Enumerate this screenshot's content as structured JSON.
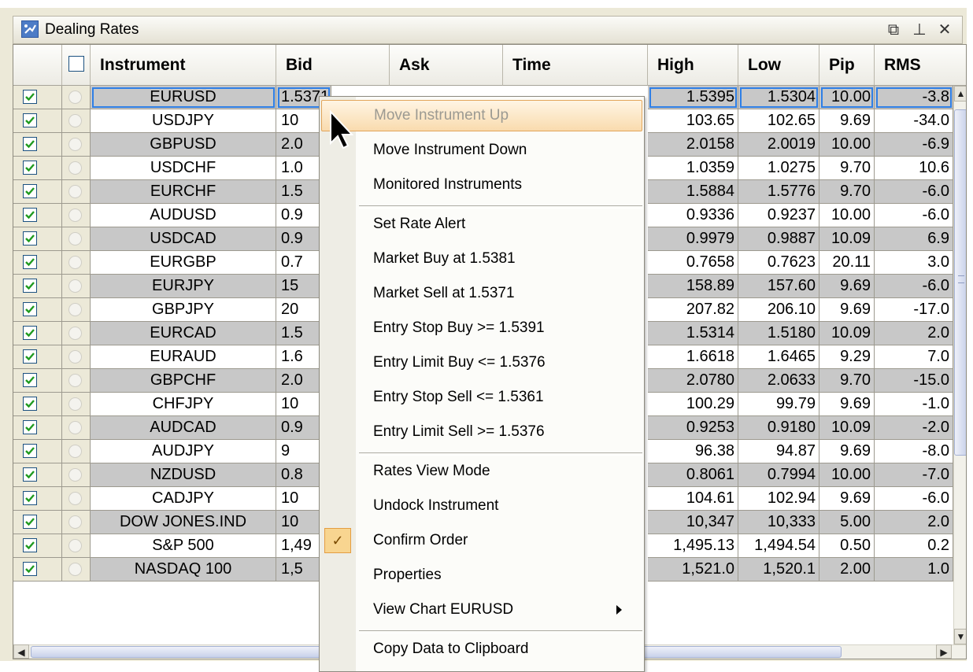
{
  "window": {
    "title": "Dealing Rates"
  },
  "columns": [
    "Instrument",
    "Bid",
    "Ask",
    "Time",
    "High",
    "Low",
    "Pip",
    "RMS"
  ],
  "rows": [
    {
      "instrument": "EURUSD",
      "bid": "1.5371",
      "high": "1.5395",
      "low": "1.5304",
      "pip": "10.00",
      "rvs": "-3.8"
    },
    {
      "instrument": "USDJPY",
      "bid": "10",
      "high": "103.65",
      "low": "102.65",
      "pip": "9.69",
      "rvs": "-34.0"
    },
    {
      "instrument": "GBPUSD",
      "bid": "2.0",
      "high": "2.0158",
      "low": "2.0019",
      "pip": "10.00",
      "rvs": "-6.9"
    },
    {
      "instrument": "USDCHF",
      "bid": "1.0",
      "high": "1.0359",
      "low": "1.0275",
      "pip": "9.70",
      "rvs": "10.6"
    },
    {
      "instrument": "EURCHF",
      "bid": "1.5",
      "high": "1.5884",
      "low": "1.5776",
      "pip": "9.70",
      "rvs": "-6.0"
    },
    {
      "instrument": "AUDUSD",
      "bid": "0.9",
      "high": "0.9336",
      "low": "0.9237",
      "pip": "10.00",
      "rvs": "-6.0"
    },
    {
      "instrument": "USDCAD",
      "bid": "0.9",
      "high": "0.9979",
      "low": "0.9887",
      "pip": "10.09",
      "rvs": "6.9"
    },
    {
      "instrument": "EURGBP",
      "bid": "0.7",
      "high": "0.7658",
      "low": "0.7623",
      "pip": "20.11",
      "rvs": "3.0"
    },
    {
      "instrument": "EURJPY",
      "bid": "15",
      "high": "158.89",
      "low": "157.60",
      "pip": "9.69",
      "rvs": "-6.0"
    },
    {
      "instrument": "GBPJPY",
      "bid": "20",
      "high": "207.82",
      "low": "206.10",
      "pip": "9.69",
      "rvs": "-17.0"
    },
    {
      "instrument": "EURCAD",
      "bid": "1.5",
      "high": "1.5314",
      "low": "1.5180",
      "pip": "10.09",
      "rvs": "2.0"
    },
    {
      "instrument": "EURAUD",
      "bid": "1.6",
      "high": "1.6618",
      "low": "1.6465",
      "pip": "9.29",
      "rvs": "7.0"
    },
    {
      "instrument": "GBPCHF",
      "bid": "2.0",
      "high": "2.0780",
      "low": "2.0633",
      "pip": "9.70",
      "rvs": "-15.0"
    },
    {
      "instrument": "CHFJPY",
      "bid": "10",
      "high": "100.29",
      "low": "99.79",
      "pip": "9.69",
      "rvs": "-1.0"
    },
    {
      "instrument": "AUDCAD",
      "bid": "0.9",
      "high": "0.9253",
      "low": "0.9180",
      "pip": "10.09",
      "rvs": "-2.0"
    },
    {
      "instrument": "AUDJPY",
      "bid": "9",
      "high": "96.38",
      "low": "94.87",
      "pip": "9.69",
      "rvs": "-8.0"
    },
    {
      "instrument": "NZDUSD",
      "bid": "0.8",
      "high": "0.8061",
      "low": "0.7994",
      "pip": "10.00",
      "rvs": "-7.0"
    },
    {
      "instrument": "CADJPY",
      "bid": "10",
      "high": "104.61",
      "low": "102.94",
      "pip": "9.69",
      "rvs": "-6.0"
    },
    {
      "instrument": "DOW JONES.IND",
      "bid": "10",
      "high": "10,347",
      "low": "10,333",
      "pip": "5.00",
      "rvs": "2.0"
    },
    {
      "instrument": "S&P 500",
      "bid": "1,49",
      "high": "1,495.13",
      "low": "1,494.54",
      "pip": "0.50",
      "rvs": "0.2"
    },
    {
      "instrument": "NASDAQ 100",
      "bid": "1,5",
      "high": "1,521.0",
      "low": "1,520.1",
      "pip": "2.00",
      "rvs": "1.0"
    }
  ],
  "context_menu": {
    "items": [
      {
        "label": "Move Instrument Up",
        "state": "disabled"
      },
      {
        "label": "Move Instrument Down"
      },
      {
        "label": "Monitored Instruments"
      },
      {
        "label": "Set Rate Alert"
      },
      {
        "label": "Market Buy at 1.5381"
      },
      {
        "label": "Market Sell at 1.5371"
      },
      {
        "label": "Entry Stop Buy >= 1.5391"
      },
      {
        "label": "Entry Limit Buy <= 1.5376"
      },
      {
        "label": "Entry Stop Sell <= 1.5361"
      },
      {
        "label": "Entry Limit Sell >= 1.5376"
      },
      {
        "label": "Rates View Mode"
      },
      {
        "label": "Undock Instrument"
      },
      {
        "label": "Confirm Order",
        "checked": true
      },
      {
        "label": "Properties"
      },
      {
        "label": "View Chart EURUSD",
        "submenu": true
      },
      {
        "label": "Copy Data to Clipboard"
      }
    ]
  },
  "colors": {
    "accent": "#2f7fe6",
    "row_shade": "#c8c8c8",
    "menu_highlight": "#f9dbae",
    "check_green": "#1f9a1f"
  }
}
